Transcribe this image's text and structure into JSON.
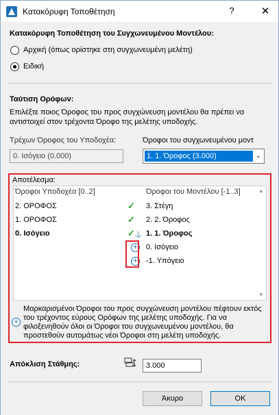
{
  "window": {
    "title": "Κατακόρυφη Τοποθέτηση",
    "help": "?",
    "close": "✕"
  },
  "vertical": {
    "heading": "Κατακόρυφη Τοποθέτηση του Συγχωνευμένου Μοντέλου:",
    "option_original": "Αρχική (όπως ορίστηκε στη συγχωνευμένη μελέτη)",
    "option_custom": "Ειδική",
    "selected": "custom"
  },
  "stories": {
    "heading": "Ταύτιση Ορόφων:",
    "description_1": "Επιλέξτε ποιος Όροφος του προς συγχώνευση μοντέλου θα πρέπει να",
    "description_2": "αντιστοιχεί στον τρέχοντα Όροφο της μελέτης υποδοχής.",
    "host_label": "Τρέχων Όροφος του Υποδοχέα:",
    "host_value": "0. Ισόγειο (0.000)",
    "merged_label": "Όροφοι του συγχωνευμένου μοντ",
    "merged_value": "1. 1. Όροφος (3.000)"
  },
  "result": {
    "label": "Αποτέλεσμα:",
    "col_host": "Όροφοι Υποδοχέα [0..2]",
    "col_model": "Όροφοι του Μοντέλου [-1..3]",
    "rows": [
      {
        "host": "2. ΟΡΟΦΟΣ",
        "status": "check",
        "model": "3. Στέγη",
        "bold": false
      },
      {
        "host": "1. ΟΡΟΦΟΣ",
        "status": "check",
        "model": "2. 2. Όροφος",
        "bold": false
      },
      {
        "host": "0. Ισόγειο",
        "status": "check-anchor",
        "model": "1. 1. Όροφος",
        "bold": true
      },
      {
        "host": "",
        "status": "plus",
        "model": "0. Ισόγειο",
        "bold": false
      },
      {
        "host": "",
        "status": "plus",
        "model": "-1. Υπόγειο",
        "bold": false
      }
    ],
    "note": "Μαρκαρισμένοι Όροφοι του προς συγχώνευση μοντέλου πέφτουν εκτός του τρέχοντος εύρους Ορόφων της μελέτης υποδοχής. Για να φιλοξενηθούν όλοι οι Όροφοι του συγχωνευμένου μοντέλου, θα προστεθούν αυτομάτως νέοι Όροφοι στη μελέτη υποδοχής."
  },
  "offset": {
    "label": "Απόκλιση Στάθμης:",
    "value": "3.000"
  },
  "buttons": {
    "cancel": "Άκυρο",
    "ok": "OK"
  },
  "colors": {
    "highlight_frame": "#e0242a",
    "selection": "#0078d7",
    "check": "#2aa52a",
    "plus": "#1b6ec2"
  }
}
